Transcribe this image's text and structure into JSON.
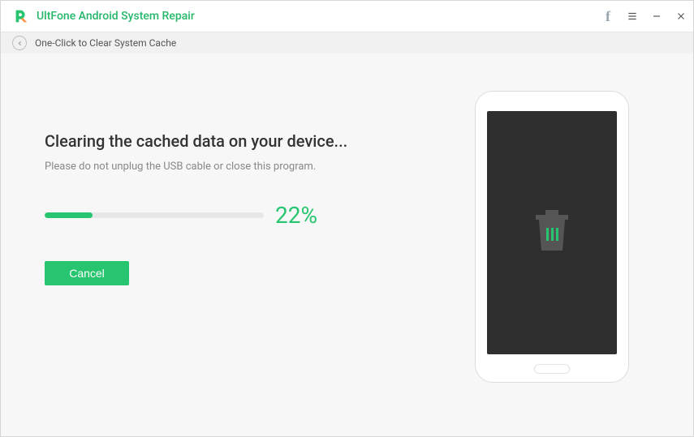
{
  "app": {
    "title": "UltFone Android System Repair"
  },
  "breadcrumb": {
    "label": "One-Click to Clear System Cache"
  },
  "progress": {
    "heading": "Clearing the cached data on your device...",
    "subtext": "Please do not unplug the USB cable or close this program.",
    "percent": 22,
    "percent_label": "22%",
    "cancel_label": "Cancel"
  },
  "colors": {
    "accent": "#27c56f",
    "brand": "#27b76a"
  }
}
